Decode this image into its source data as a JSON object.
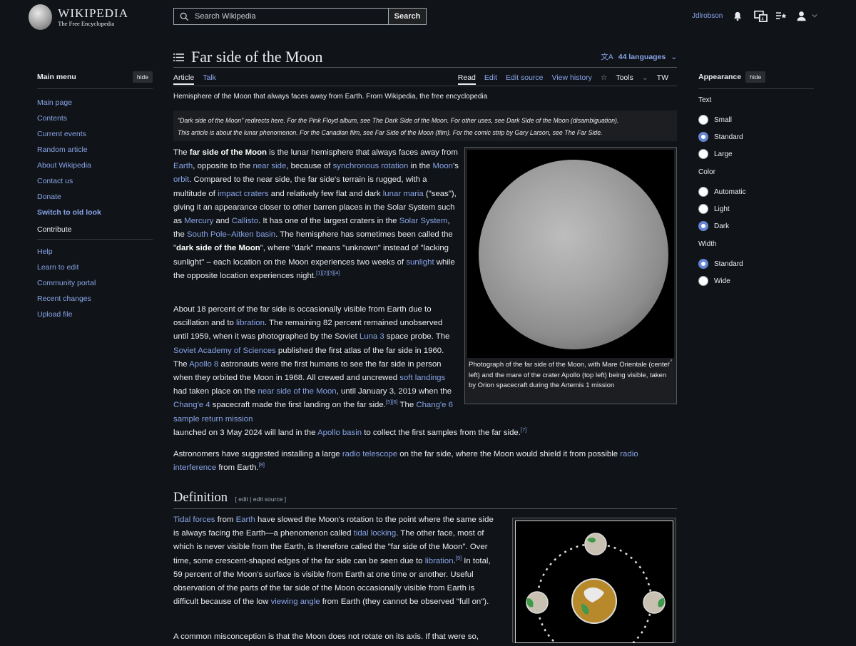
{
  "header": {
    "logo_title": "Wikipedia",
    "logo_tagline": "The Free Encyclopedia",
    "search_placeholder": "Search Wikipedia",
    "search_button": "Search",
    "username": "Jdlrobson",
    "icons": [
      "bell-icon",
      "translate-icon",
      "watchlist-icon",
      "user-icon",
      "chevron-down-icon"
    ]
  },
  "left_menu": {
    "title": "Main menu",
    "hide": "hide",
    "items": [
      "Main page",
      "Contents",
      "Current events",
      "Random article",
      "About Wikipedia",
      "Contact us",
      "Donate"
    ],
    "switch": "Switch to old look",
    "contribute": "Contribute",
    "contribute_items": [
      "Help",
      "Learn to edit",
      "Community portal",
      "Recent changes",
      "Upload file"
    ]
  },
  "page": {
    "title": "Far side of the Moon",
    "languages": "44 languages",
    "tabs_left": [
      "Article",
      "Talk"
    ],
    "tabs_right": [
      "Read",
      "Edit",
      "Edit source",
      "View history",
      "Tools",
      "TW"
    ],
    "tagline": "Hemisphere of the Moon that always faces away from Earth. From Wikipedia, the free encyclopedia",
    "hatnote_1": "\"Dark side of the Moon\" redirects here. For the Pink Floyd album, see The Dark Side of the Moon. For other uses, see Dark Side of the Moon (disambiguation).",
    "hatnote_2": "This article is about the lunar phenomenon. For the Canadian film, see Far Side of the Moon (film). For the comic strip by Gary Larson, see The Far Side.",
    "figure_caption": "Photograph of the far side of the Moon, with Mare Orientale (center left) and the mare of the crater Apollo (top left) being visible, taken by Orion spacecraft during the Artemis 1 mission",
    "definition_heading": "Definition",
    "definition_edit": "[ edit | edit source ]"
  },
  "appearance": {
    "title": "Appearance",
    "hide": "hide",
    "text_label": "Text",
    "text_options": [
      "Small",
      "Standard",
      "Large"
    ],
    "text_selected": "Standard",
    "color_label": "Color",
    "color_options": [
      "Automatic",
      "Light",
      "Dark"
    ],
    "color_selected": "Dark",
    "width_label": "Width",
    "width_options": [
      "Standard",
      "Wide"
    ],
    "width_selected": "Standard"
  },
  "colors": {
    "background": "#101418",
    "link": "#88a3e8",
    "text": "#eaecf0",
    "accent": "#6485d1"
  }
}
